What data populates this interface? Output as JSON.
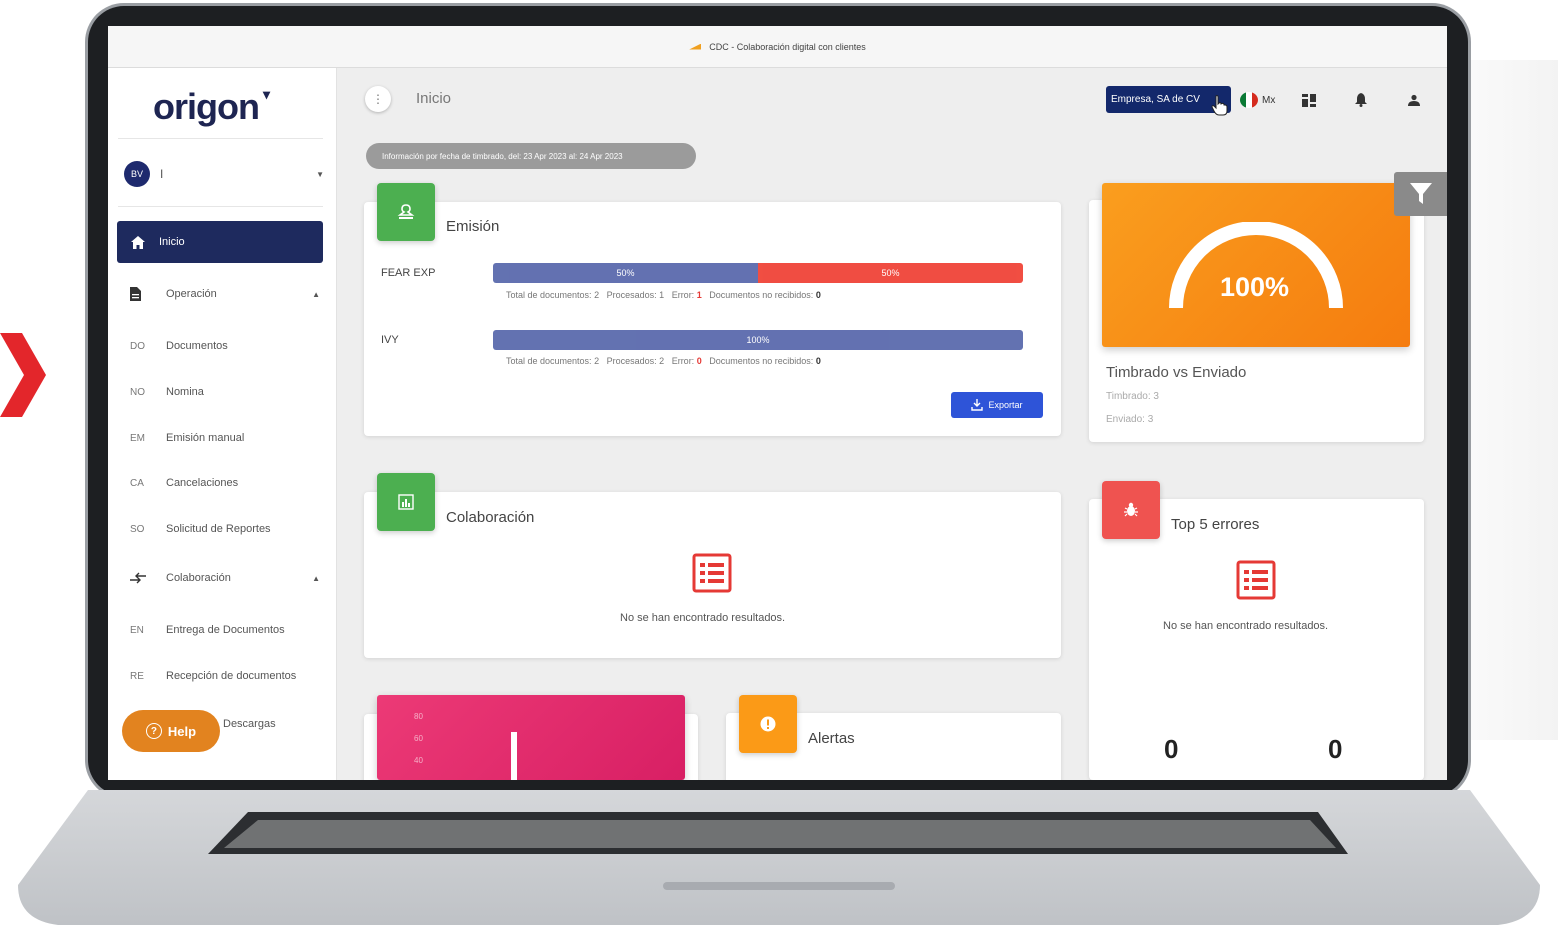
{
  "window": {
    "title": "CDC - Colaboración digital con clientes"
  },
  "brand": {
    "logo_text": "origon",
    "accent": "#1e2a5e"
  },
  "user": {
    "initials": "BV",
    "name": "I"
  },
  "sidebar": {
    "active": {
      "label": "Inicio",
      "icon": "home-icon"
    },
    "items": [
      {
        "label": "Operación",
        "icon": "document-icon",
        "abbr": "",
        "expandable": true
      },
      {
        "label": "Documentos",
        "abbr": "DO"
      },
      {
        "label": "Nomina",
        "abbr": "NO"
      },
      {
        "label": "Emisión manual",
        "abbr": "EM"
      },
      {
        "label": "Cancelaciones",
        "abbr": "CA"
      },
      {
        "label": "Solicitud de Reportes",
        "abbr": "SO"
      },
      {
        "label": "Colaboración",
        "icon": "transfer-icon",
        "abbr": "",
        "expandable": true
      },
      {
        "label": "Entrega de Documentos",
        "abbr": "EN"
      },
      {
        "label": "Recepción de documentos",
        "abbr": "RE"
      },
      {
        "label": "Descargas",
        "abbr": ""
      }
    ],
    "help_label": "Help"
  },
  "header": {
    "page_title": "Inicio",
    "company": "Empresa, SA de CV",
    "locale": "Mx"
  },
  "info_pill": "Información por fecha de timbrado, del: 23 Apr 2023 al: 24 Apr 2023",
  "emision": {
    "title": "Emisión",
    "rows": [
      {
        "label": "FEAR EXP",
        "segments": [
          {
            "pct": 50,
            "label": "50%",
            "color": "#5b6aad"
          },
          {
            "pct": 50,
            "label": "50%",
            "color": "#f04438"
          }
        ],
        "stats": {
          "total_label": "Total de documentos:",
          "total": "2",
          "proc_label": "Procesados:",
          "proc": "1",
          "err_label": "Error:",
          "err": "1",
          "norec_label": "Documentos no recibidos:",
          "norec": "0"
        }
      },
      {
        "label": "IVY",
        "segments": [
          {
            "pct": 100,
            "label": "100%",
            "color": "#5b6aad"
          }
        ],
        "stats": {
          "total_label": "Total de documentos:",
          "total": "2",
          "proc_label": "Procesados:",
          "proc": "2",
          "err_label": "Error:",
          "err": "0",
          "norec_label": "Documentos no recibidos:",
          "norec": "0"
        }
      }
    ],
    "export_label": "Exportar"
  },
  "colaboracion": {
    "title": "Colaboración",
    "empty": "No se han encontrado resultados."
  },
  "timbrado": {
    "percent": "100%",
    "title": "Timbrado vs Enviado",
    "timbrado": "Timbrado: 3",
    "enviado": "Enviado: 3",
    "gauge_value": 1.0
  },
  "top_errores": {
    "title": "Top 5 errores",
    "empty": "No se han encontrado resultados.",
    "count_left": "0",
    "count_right": "0"
  },
  "alertas": {
    "title": "Alertas"
  },
  "mini_chart": {
    "ticks": [
      "80",
      "60",
      "40"
    ]
  }
}
